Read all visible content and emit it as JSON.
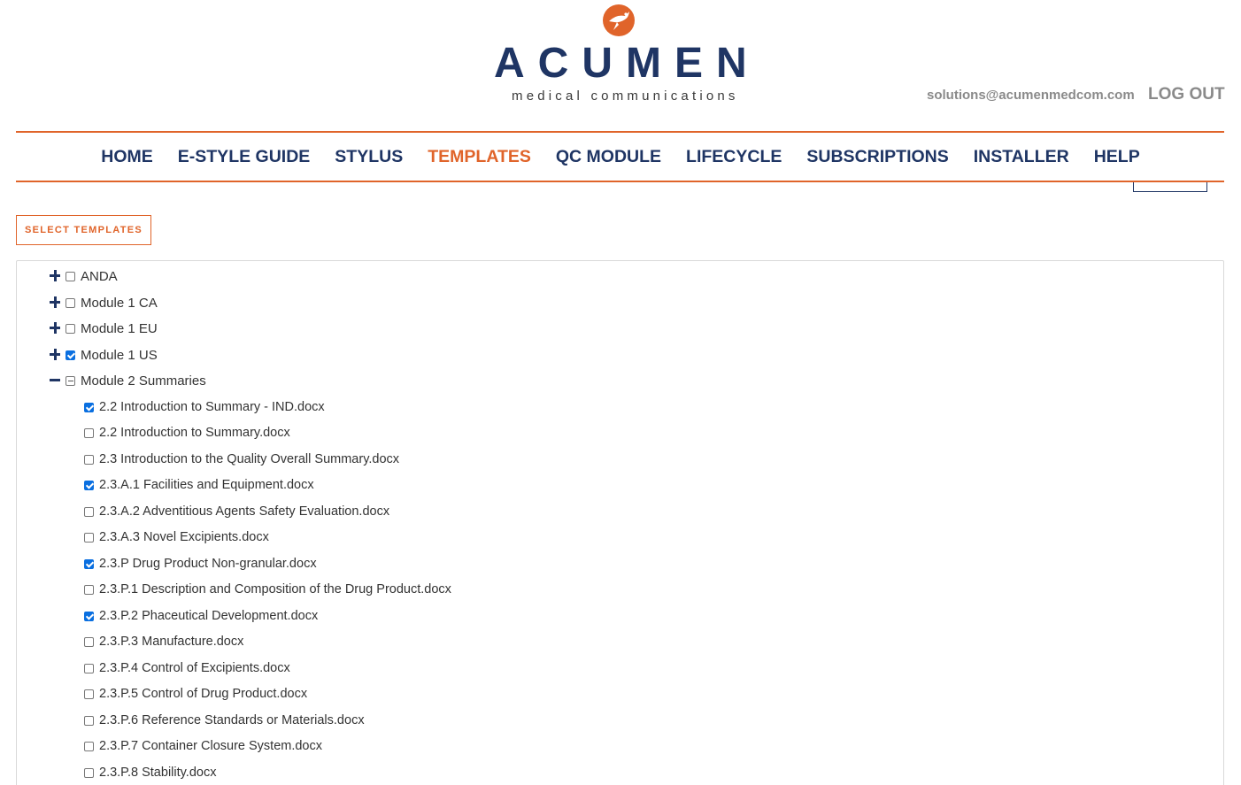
{
  "brand": {
    "name": "ACUMEN",
    "tagline": "medical communications",
    "accent_color": "#e0642a",
    "primary_color": "#1f3564"
  },
  "user": {
    "email": "solutions@acumenmedcom.com",
    "logout_label": "LOG OUT"
  },
  "nav": {
    "items": [
      {
        "label": "HOME",
        "active": false
      },
      {
        "label": "E-STYLE GUIDE",
        "active": false
      },
      {
        "label": "STYLUS",
        "active": false
      },
      {
        "label": "TEMPLATES",
        "active": true
      },
      {
        "label": "QC MODULE",
        "active": false
      },
      {
        "label": "LIFECYCLE",
        "active": false
      },
      {
        "label": "SUBSCRIPTIONS",
        "active": false
      },
      {
        "label": "INSTALLER",
        "active": false
      },
      {
        "label": "HELP",
        "active": false
      }
    ]
  },
  "select_button": {
    "label": "SELECT TEMPLATES"
  },
  "tree": {
    "folders": [
      {
        "label": "ANDA",
        "expanded": false,
        "state": "unchecked"
      },
      {
        "label": "Module 1 CA",
        "expanded": false,
        "state": "unchecked"
      },
      {
        "label": "Module 1 EU",
        "expanded": false,
        "state": "unchecked"
      },
      {
        "label": "Module 1 US",
        "expanded": false,
        "state": "checked"
      },
      {
        "label": "Module 2 Summaries",
        "expanded": true,
        "state": "partial"
      }
    ],
    "files": [
      {
        "label": "2.2 Introduction to Summary - IND.docx",
        "checked": true
      },
      {
        "label": "2.2 Introduction to Summary.docx",
        "checked": false
      },
      {
        "label": "2.3 Introduction to the Quality Overall Summary.docx",
        "checked": false
      },
      {
        "label": "2.3.A.1 Facilities and Equipment.docx",
        "checked": true
      },
      {
        "label": "2.3.A.2 Adventitious Agents Safety Evaluation.docx",
        "checked": false
      },
      {
        "label": "2.3.A.3 Novel Excipients.docx",
        "checked": false
      },
      {
        "label": "2.3.P Drug Product Non-granular.docx",
        "checked": true
      },
      {
        "label": "2.3.P.1 Description and Composition of the Drug Product.docx",
        "checked": false
      },
      {
        "label": "2.3.P.2 Phaceutical Development.docx",
        "checked": true
      },
      {
        "label": "2.3.P.3 Manufacture.docx",
        "checked": false
      },
      {
        "label": "2.3.P.4 Control of Excipients.docx",
        "checked": false
      },
      {
        "label": "2.3.P.5 Control of Drug Product.docx",
        "checked": false
      },
      {
        "label": "2.3.P.6 Reference Standards or Materials.docx",
        "checked": false
      },
      {
        "label": "2.3.P.7 Container Closure System.docx",
        "checked": false
      },
      {
        "label": "2.3.P.8 Stability.docx",
        "checked": false
      }
    ]
  }
}
